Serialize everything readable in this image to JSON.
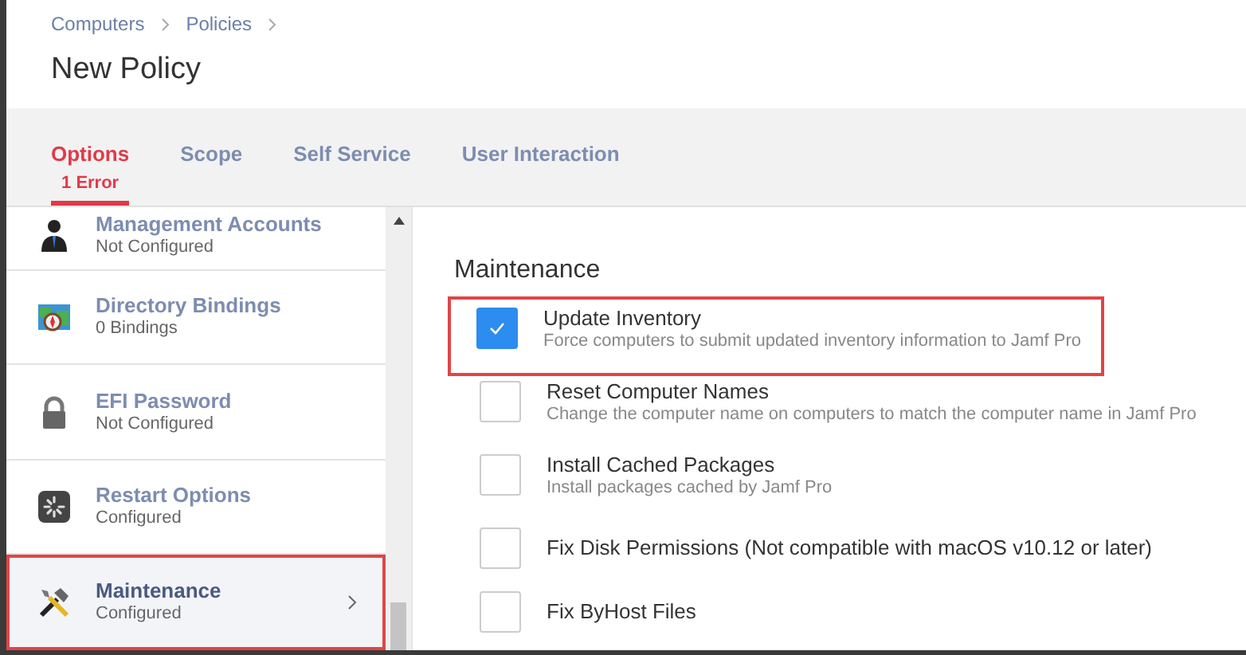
{
  "breadcrumb": [
    "Computers",
    "Policies"
  ],
  "title": "New Policy",
  "tabs": [
    {
      "label": "Options",
      "error": "1 Error",
      "selected": true
    },
    {
      "label": "Scope",
      "selected": false
    },
    {
      "label": "Self Service",
      "selected": false
    },
    {
      "label": "User Interaction",
      "selected": false
    }
  ],
  "sidebar": {
    "items": [
      {
        "kind": "accounts",
        "title": "Management Accounts",
        "status": "Not Configured",
        "selected": false,
        "highlighted": false
      },
      {
        "kind": "directory",
        "title": "Directory Bindings",
        "status": "0 Bindings",
        "selected": false,
        "highlighted": false
      },
      {
        "kind": "lock",
        "title": "EFI Password",
        "status": "Not Configured",
        "selected": false,
        "highlighted": false
      },
      {
        "kind": "restart",
        "title": "Restart Options",
        "status": "Configured",
        "selected": false,
        "highlighted": false
      },
      {
        "kind": "tools",
        "title": "Maintenance",
        "status": "Configured",
        "selected": true,
        "highlighted": true
      }
    ]
  },
  "section": {
    "title": "Maintenance",
    "options": [
      {
        "label": "Update Inventory",
        "description": "Force computers to submit updated inventory information to Jamf Pro",
        "checked": true,
        "highlighted": true
      },
      {
        "label": "Reset Computer Names",
        "description": "Change the computer name on computers to match the computer name in Jamf Pro",
        "checked": false,
        "highlighted": false
      },
      {
        "label": "Install Cached Packages",
        "description": "Install packages cached by Jamf Pro",
        "checked": false,
        "highlighted": false
      },
      {
        "label": "Fix Disk Permissions (Not compatible with macOS v10.12 or later)",
        "checked": false,
        "highlighted": false
      },
      {
        "label": "Fix ByHost Files",
        "checked": false,
        "highlighted": false
      }
    ]
  }
}
